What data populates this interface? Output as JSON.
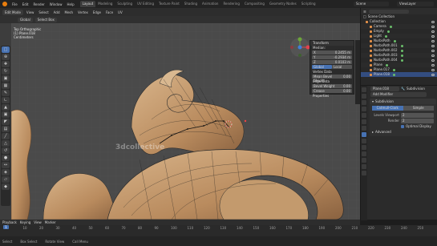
{
  "topbar": {
    "menus": [
      "File",
      "Edit",
      "Render",
      "Window",
      "Help"
    ],
    "workspaces": [
      "Layout",
      "Modeling",
      "Sculpting",
      "UV Editing",
      "Texture Paint",
      "Shading",
      "Animation",
      "Rendering",
      "Compositing",
      "Geometry Nodes",
      "Scripting"
    ],
    "active_workspace": "Layout",
    "scene": "Scene",
    "view_layer": "ViewLayer"
  },
  "viewport": {
    "mode": "Edit Mode",
    "menus": [
      "View",
      "Select",
      "Add",
      "Mesh",
      "Vertex",
      "Edge",
      "Face",
      "UV"
    ],
    "tool_options": [
      "Global",
      "Select Box"
    ],
    "overlay": [
      "Top Orthographic",
      "(1) Plane.018",
      "Centimeters"
    ]
  },
  "npanel": {
    "title": "Transform",
    "median_label": "Median:",
    "fields": [
      {
        "k": "X",
        "v": "0.2455 m"
      },
      {
        "k": "Y",
        "v": "-0.2934 m"
      },
      {
        "k": "Z",
        "v": "0.0103 m"
      }
    ],
    "global_local": [
      "Global",
      "Local"
    ],
    "vertex_data_title": "Vertex Data",
    "mean_bevel_weight": {
      "k": "Mean Bevel Weight",
      "v": "0.00"
    },
    "edge_data_title": "Edge Data",
    "bevel_weight": {
      "k": "Bevel Weight",
      "v": "0.00"
    },
    "crease": {
      "k": "Crease",
      "v": "0.00"
    },
    "properties_title": "Properties"
  },
  "outliner": {
    "title": "Scene Collection",
    "items": [
      {
        "label": "Collection",
        "indent": 0
      },
      {
        "label": "Camera",
        "indent": 1
      },
      {
        "label": "Empty",
        "indent": 1
      },
      {
        "label": "Light",
        "indent": 1
      },
      {
        "label": "NurbsPath",
        "indent": 1
      },
      {
        "label": "NurbsPath.001",
        "indent": 1
      },
      {
        "label": "NurbsPath.002",
        "indent": 1
      },
      {
        "label": "NurbsPath.003",
        "indent": 1
      },
      {
        "label": "NurbsPath.004",
        "indent": 1
      },
      {
        "label": "Plane",
        "indent": 1
      },
      {
        "label": "Plane.017",
        "indent": 1
      },
      {
        "label": "Plane.018",
        "indent": 1,
        "selected": true
      }
    ]
  },
  "properties": {
    "object_name": "Plane.018",
    "modifier_name_label": "Subdivision",
    "add_modifier": "Add Modifier",
    "modifier": {
      "name": "Subdivision",
      "seg": [
        "Catmull-Clark",
        "Simple"
      ],
      "active_seg": "Catmull-Clark",
      "levels_viewport": {
        "k": "Levels Viewport",
        "v": "2"
      },
      "render": {
        "k": "Render",
        "v": "2"
      },
      "optimal_display": "Optimal Display",
      "advanced": "Advanced"
    }
  },
  "timeline": {
    "menus": [
      "Playback",
      "Keying",
      "View",
      "Marker"
    ],
    "current_frame": "1",
    "ticks": [
      "0",
      "10",
      "20",
      "30",
      "40",
      "50",
      "60",
      "70",
      "80",
      "90",
      "100",
      "110",
      "120",
      "130",
      "140",
      "150",
      "160",
      "170",
      "180",
      "190",
      "200",
      "210",
      "220",
      "230",
      "240",
      "250"
    ]
  },
  "status": {
    "items": [
      "Select",
      "Box Select",
      "Rotate View",
      "Call Menu"
    ]
  },
  "watermark": "3dcollective",
  "colors": {
    "accent": "#4772b3",
    "ornament": "#c8a57c",
    "ornament_dark": "#8f6a45"
  }
}
